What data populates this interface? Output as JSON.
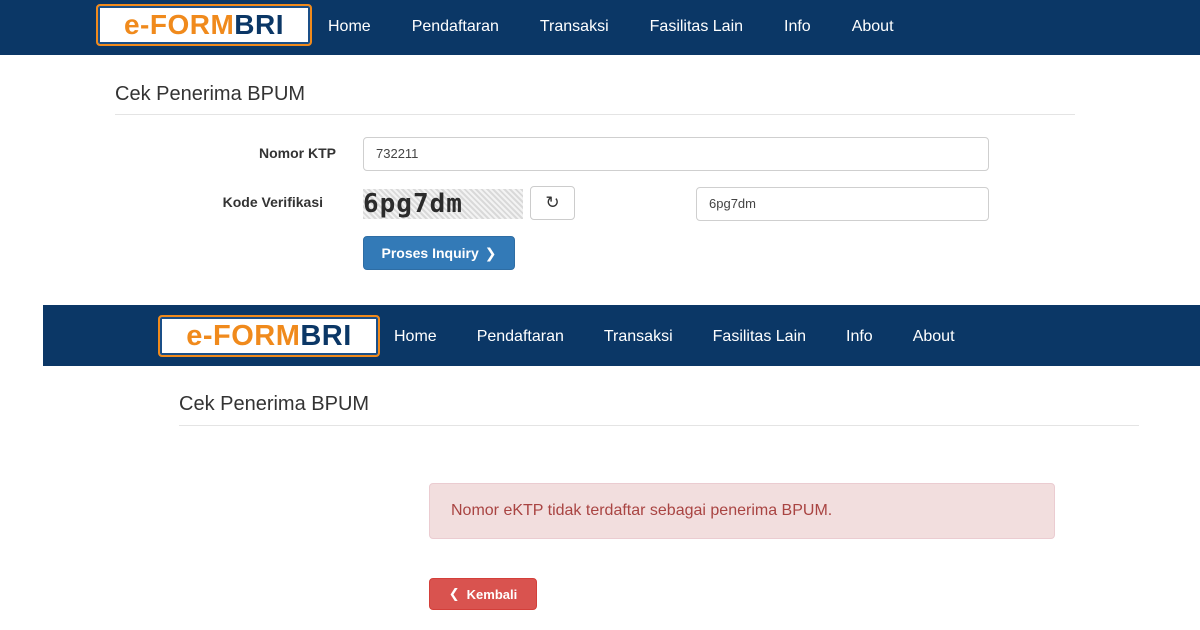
{
  "brand": {
    "prefix": "e-FORM",
    "suffix": "BRI"
  },
  "nav": {
    "items": [
      {
        "label": "Home"
      },
      {
        "label": "Pendaftaran"
      },
      {
        "label": "Transaksi"
      },
      {
        "label": "Fasilitas Lain"
      },
      {
        "label": "Info"
      },
      {
        "label": "About"
      }
    ]
  },
  "form": {
    "title": "Cek Penerima BPUM",
    "ktp_label": "Nomor KTP",
    "ktp_value": "732211",
    "verif_label": "Kode Verifikasi",
    "captcha_text": "6pg7dm",
    "verif_value": "6pg7dm",
    "submit_label": "Proses Inquiry",
    "submit_icon": "chevron-right-icon",
    "refresh_icon": "refresh-icon"
  },
  "result": {
    "title": "Cek Penerima BPUM",
    "alert_text": "Nomor eKTP tidak terdaftar sebagai penerima BPUM.",
    "back_label": "Kembali",
    "back_icon": "chevron-left-icon"
  },
  "colors": {
    "navbar": "#0b3766",
    "brand_orange": "#f08a1c",
    "primary": "#337ab7",
    "danger": "#d9534f",
    "alert_bg": "#f2dede",
    "alert_text": "#a94442"
  }
}
